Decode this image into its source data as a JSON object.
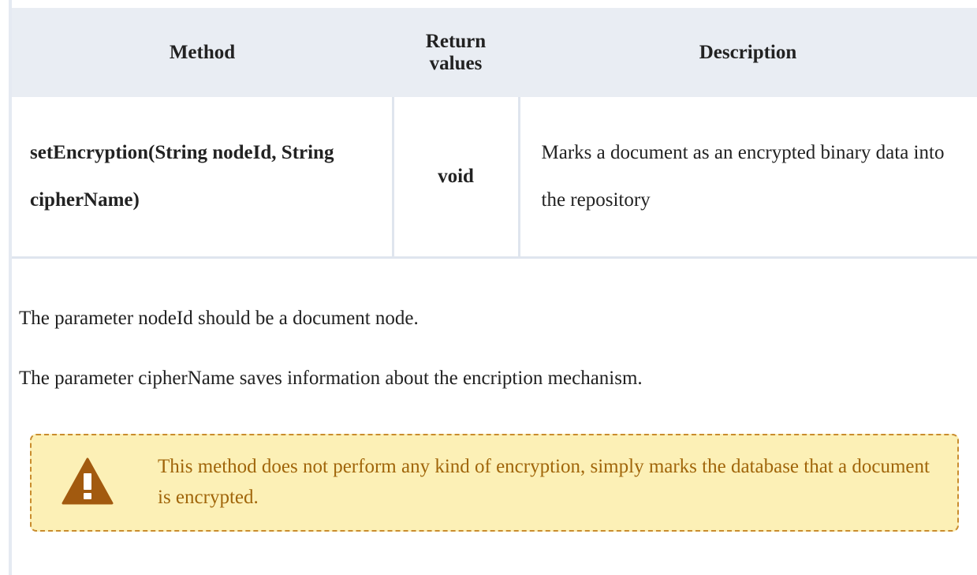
{
  "table": {
    "headers": {
      "method": "Method",
      "return_values": "Return values",
      "description": "Description"
    },
    "row": {
      "method": "setEncryption(String nodeId, String cipherName)",
      "return_value": "void",
      "description": "Marks a document as an encrypted binary data into the repository"
    }
  },
  "paragraphs": {
    "node_id": "The parameter nodeId should be a document node.",
    "cipher_name": "The parameter cipherName saves information about the encription mechanism."
  },
  "warning": {
    "icon": "warning-icon",
    "text": "This method does not perform any kind of encryption, simply marks the database that a document is encrypted."
  },
  "colors": {
    "header_bg": "#e9edf3",
    "border": "#dfe5ee",
    "warning_bg": "#fcf0b6",
    "warning_border": "#c98c2e",
    "warning_text": "#a0650a",
    "warning_icon": "#a25a0f"
  }
}
